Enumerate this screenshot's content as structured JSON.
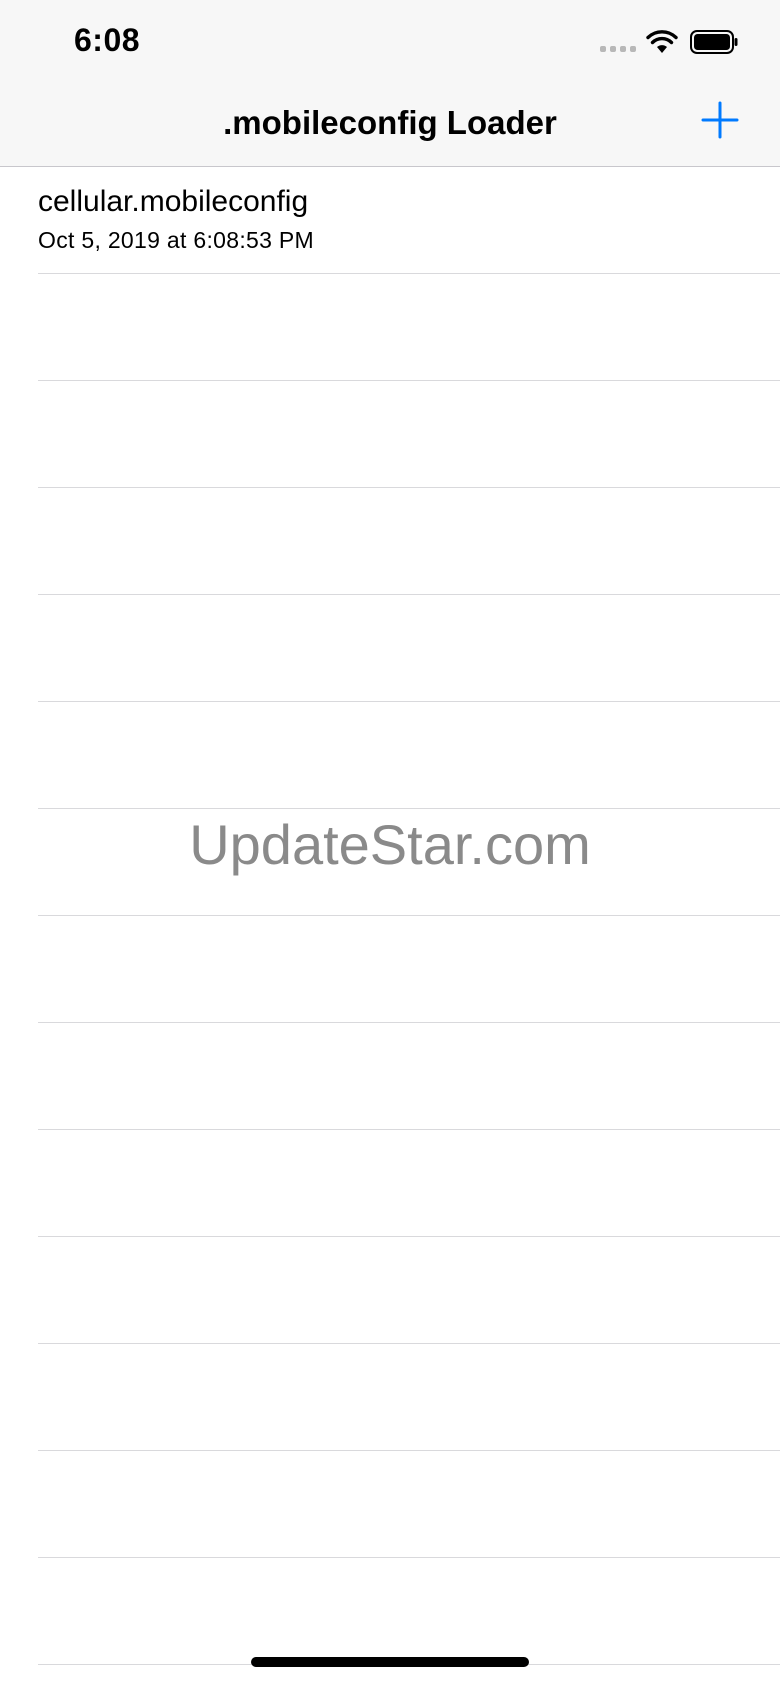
{
  "status_bar": {
    "time": "6:08"
  },
  "nav": {
    "title": ".mobileconfig Loader"
  },
  "list": {
    "items": [
      {
        "title": "cellular.mobileconfig",
        "subtitle": "Oct 5, 2019 at 6:08:53 PM"
      }
    ]
  },
  "watermark": "UpdateStar.com",
  "colors": {
    "accent": "#007aff",
    "bar_background": "#f7f7f7",
    "separator": "#d9d9dc"
  }
}
